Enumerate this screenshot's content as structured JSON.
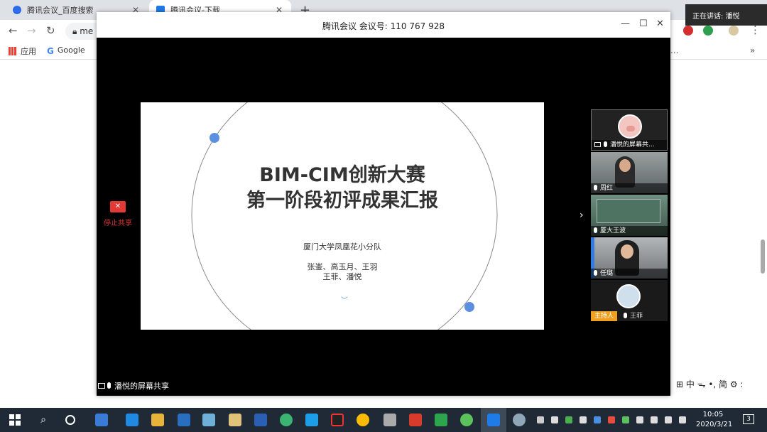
{
  "browser": {
    "tabs": [
      {
        "title": "腾讯会议_百度搜索",
        "close": "✕"
      },
      {
        "title": "腾讯会议-下载",
        "close": "✕"
      }
    ],
    "new_tab": "+",
    "omnibox_text": "me",
    "bookmarks": [
      {
        "label": "应用"
      },
      {
        "label": "Google"
      }
    ],
    "more_bookmarks": "»",
    "overflow": "..."
  },
  "speaking_notice": "正在讲话: 潘悦",
  "meeting": {
    "title": "腾讯会议 会议号: 110 767 928",
    "stop_share_label": "停止共享",
    "screen_share_label": "潘悦的屏幕共享",
    "slide": {
      "title_line1": "BIM-CIM创新大赛",
      "title_line2": "第一阶段初评成果汇报",
      "team": "厦门大学凤凰花小分队",
      "members_line1": "张崟、高玉月、王羽",
      "members_line2": "王菲、潘悦",
      "accent_color": "#5b8fe0"
    },
    "participants": [
      {
        "name": "潘悦的屏幕共..."
      },
      {
        "name": "周红"
      },
      {
        "name": "厦大王波"
      },
      {
        "name": "任璐"
      },
      {
        "name": "王菲",
        "role": "主持人"
      }
    ]
  },
  "ime": "中 ᯓ •, 简 ⚙ :",
  "taskbar": {
    "time": "10:05",
    "date": "2020/3/21",
    "notifications": "3"
  }
}
